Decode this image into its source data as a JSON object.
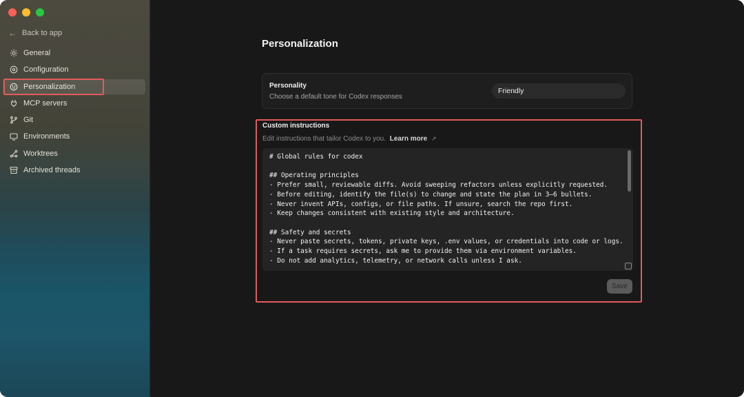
{
  "sidebar": {
    "back_label": "Back to app",
    "items": [
      {
        "label": "General",
        "icon": "gear-icon"
      },
      {
        "label": "Configuration",
        "icon": "settings-icon"
      },
      {
        "label": "Personalization",
        "icon": "smiley-icon",
        "active": true
      },
      {
        "label": "MCP servers",
        "icon": "plug-icon"
      },
      {
        "label": "Git",
        "icon": "branch-icon"
      },
      {
        "label": "Environments",
        "icon": "monitor-icon"
      },
      {
        "label": "Worktrees",
        "icon": "worktree-icon"
      },
      {
        "label": "Archived threads",
        "icon": "archive-icon"
      }
    ]
  },
  "main": {
    "title": "Personalization",
    "personality": {
      "label": "Personality",
      "description": "Choose a default tone for Codex responses",
      "value": "Friendly"
    },
    "custom_instructions": {
      "title": "Custom instructions",
      "subtitle": "Edit instructions that tailor Codex to you.",
      "learn_more": "Learn more",
      "content": "# Global rules for codex\n\n## Operating principles\n- Prefer small, reviewable diffs. Avoid sweeping refactors unless explicitly requested.\n- Before editing, identify the file(s) to change and state the plan in 3–6 bullets.\n- Never invent APIs, configs, or file paths. If unsure, search the repo first.\n- Keep changes consistent with existing style and architecture.\n\n## Safety and secrets\n- Never paste secrets, tokens, private keys, .env values, or credentials into code or logs.\n- If a task requires secrets, ask me to provide them via environment variables.\n- Do not add analytics, telemetry, or network calls unless I ask.",
      "save_label": "Save"
    }
  },
  "colors": {
    "highlight": "#e25b5b",
    "main_bg": "#181818"
  }
}
